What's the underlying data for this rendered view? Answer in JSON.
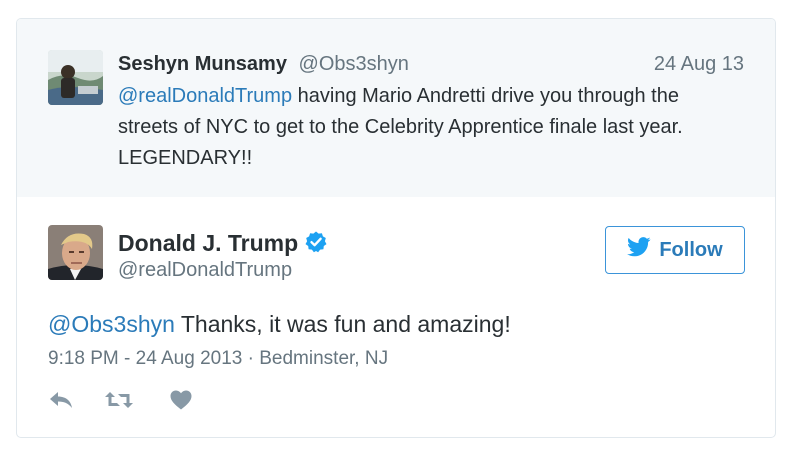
{
  "parent_tweet": {
    "author_name": "Seshyn Munsamy",
    "author_handle": "@Obs3shyn",
    "date": "24 Aug 13",
    "mention": "@realDonaldTrump",
    "text": " having Mario Andretti drive you through the streets of NYC to get to the Celebrity Apprentice finale last year. LEGENDARY!!"
  },
  "tweet": {
    "author_name": "Donald J. Trump",
    "author_handle": "@realDonaldTrump",
    "verified_icon": "verified-badge-icon",
    "follow_label": "Follow",
    "reply_mention": "@Obs3shyn",
    "text": " Thanks, it was fun and amazing!",
    "meta": "9:18 PM - 24 Aug 2013 · Bedminster, NJ"
  },
  "actions": {
    "reply_icon": "reply-icon",
    "retweet_icon": "retweet-icon",
    "like_icon": "heart-icon"
  },
  "colors": {
    "link": "#2b7bb9",
    "secondary_text": "#66757f",
    "parent_background": "#f5f8fa",
    "verified": "#1da1f2",
    "action_icon": "#8899a6"
  }
}
